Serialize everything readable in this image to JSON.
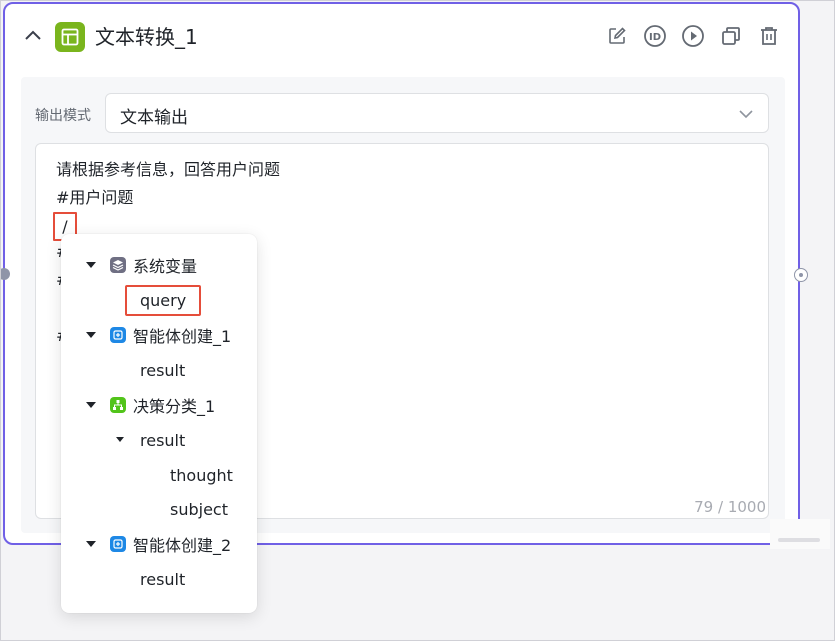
{
  "node": {
    "title": "文本转换_1",
    "icons": {
      "node": "text-transform-icon",
      "collapse": "chevron-up-icon",
      "edit": "edit-icon",
      "id": "id-icon",
      "run": "play-icon",
      "copy": "copy-icon",
      "delete": "trash-icon"
    },
    "id_glyph": "ID",
    "accent": "#7060e6",
    "node_icon_color": "#7ab51d"
  },
  "output": {
    "label": "输出模式",
    "value": "文本输出"
  },
  "editor": {
    "line1": "请根据参考信息，回答用户问题",
    "line2": "#用户问题",
    "cursor_line": "/",
    "hidden_lines": [
      "#",
      "#",
      "#"
    ],
    "counter": "79 / 1000"
  },
  "popup": {
    "items": [
      {
        "label": "系统变量",
        "icon": "system-variable-icon",
        "color": "#6f6f83"
      },
      {
        "label": "query"
      },
      {
        "label": "智能体创建_1",
        "icon": "agent-icon",
        "color": "#1e88e5"
      },
      {
        "label": "result"
      },
      {
        "label": "决策分类_1",
        "icon": "classification-icon",
        "color": "#52c41a"
      },
      {
        "label": "result"
      },
      {
        "label": "thought"
      },
      {
        "label": "subject"
      },
      {
        "label": "智能体创建_2",
        "icon": "agent-icon",
        "color": "#1e88e5"
      },
      {
        "label": "result"
      }
    ],
    "highlight_color": "#e54d3a"
  }
}
